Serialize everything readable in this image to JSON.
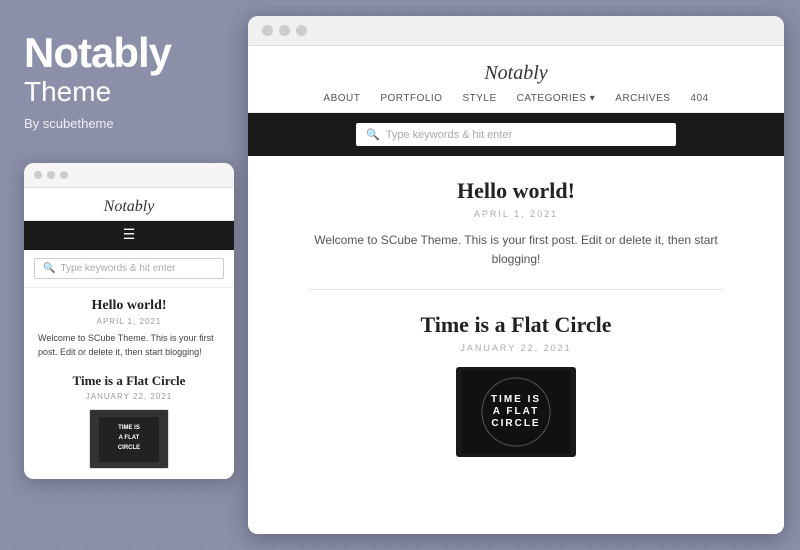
{
  "brand": {
    "title": "Notably",
    "subtitle": "Theme",
    "author": "By scubetheme"
  },
  "mobile": {
    "site_title": "Notably",
    "search_placeholder": "Type keywords & hit enter",
    "post1": {
      "title": "Hello world!",
      "date": "APRIL 1, 2021",
      "text": "Welcome to SCube Theme. This is your first post. Edit or delete it, then start blogging!"
    },
    "post2": {
      "title": "Time is a Flat Circle",
      "date": "JANUARY 22, 2021"
    }
  },
  "desktop": {
    "site_title": "Notably",
    "nav": {
      "about": "ABOUT",
      "portfolio": "PORTFOLIO",
      "style": "STYLE",
      "categories": "CATEGORIES ▾",
      "archives": "ARCHIVES",
      "404": "404"
    },
    "search_placeholder": "Type keywords & hit enter",
    "post1": {
      "title": "Hello world!",
      "date": "APRIL 1, 2021",
      "text": "Welcome to SCube Theme. This is your first post. Edit or delete it, then start blogging!"
    },
    "post2": {
      "title": "Time is a Flat Circle",
      "date": "JANUARY 22, 2021",
      "thumbnail_text": "TIME IS\nA FLAT\nCIRCLE"
    }
  },
  "icons": {
    "dot": "●",
    "search": "🔍",
    "hamburger": "☰"
  }
}
